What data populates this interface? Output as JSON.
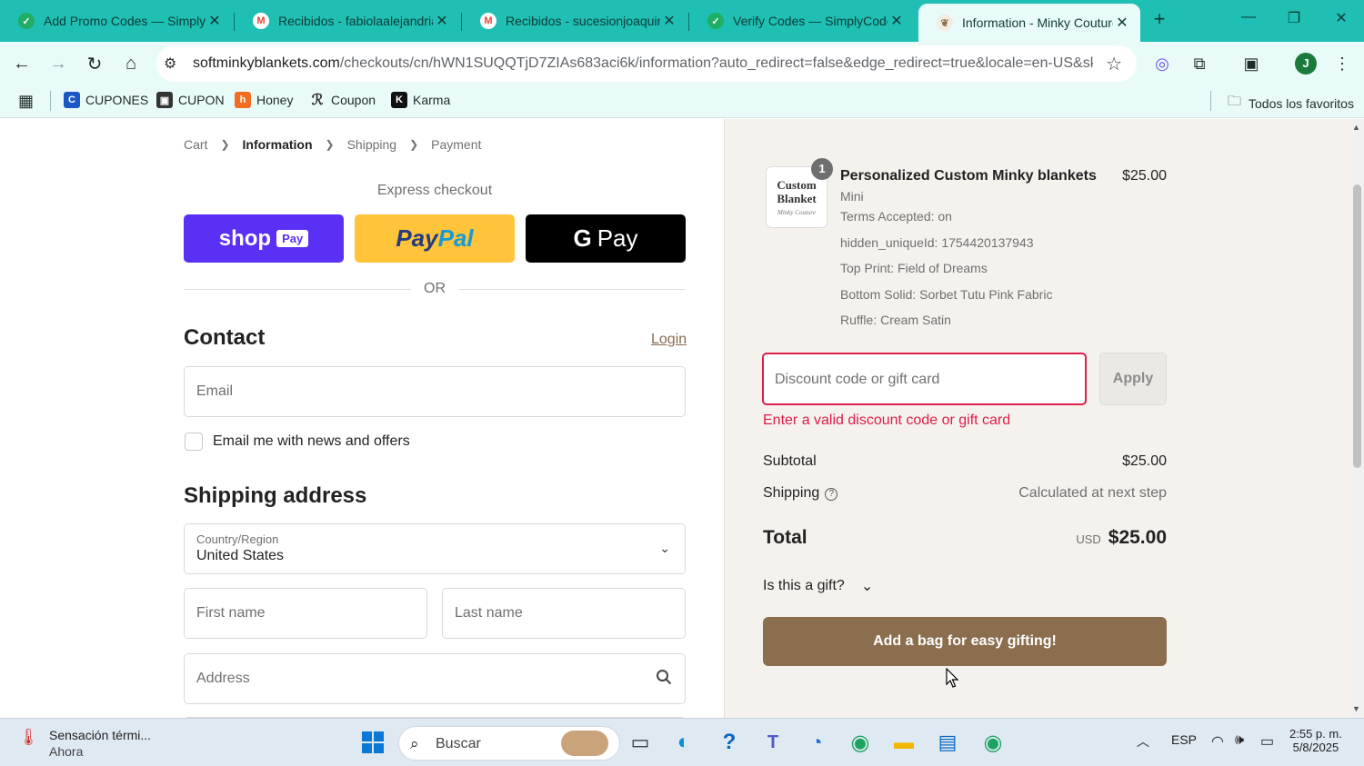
{
  "browser": {
    "tabs": [
      {
        "title": "Add Promo Codes — Simply",
        "favicon": "simplycodes-icon",
        "color": "#1fae64"
      },
      {
        "title": "Recibidos - fabiolaalejandria",
        "favicon": "gmail-icon",
        "color": "#ea4335"
      },
      {
        "title": "Recibidos - sucesionjoaquinh",
        "favicon": "gmail-icon",
        "color": "#ea4335"
      },
      {
        "title": "Verify Codes — SimplyCodes",
        "favicon": "simplycodes-icon",
        "color": "#1fae64"
      },
      {
        "title": "Information - Minky Couture",
        "favicon": "minky-icon",
        "color": "#8a6e4e"
      }
    ],
    "new_tab": "+",
    "url_domain": "softminkyblankets.com",
    "url_path": "/checkouts/cn/hWN1SUQQTjD7ZIAs683aci6k/information?auto_redirect=false&edge_redirect=true&locale=en-US&skip_...",
    "profile_initial": "J",
    "bookmarks": [
      {
        "label": "CUPONES",
        "color": "#1a56c4"
      },
      {
        "label": "CUPON",
        "color": "#333333"
      },
      {
        "label": "Honey",
        "color": "#f26c21"
      },
      {
        "label": "Coupon",
        "color": "#333333"
      },
      {
        "label": "Karma",
        "color": "#111111"
      }
    ],
    "all_bookmarks": "Todos los favoritos"
  },
  "checkout": {
    "breadcrumbs": [
      "Cart",
      "Information",
      "Shipping",
      "Payment"
    ],
    "express_checkout": "Express checkout",
    "shop_pay": {
      "shop": "shop",
      "pay": "Pay"
    },
    "paypal": {
      "pay": "Pay",
      "pal": "Pal"
    },
    "gpay": {
      "g": "G",
      "pay": "Pay"
    },
    "or": "OR",
    "contact_heading": "Contact",
    "login": "Login",
    "email_placeholder": "Email",
    "news_checkbox": "Email me with news and offers",
    "shipping_heading": "Shipping address",
    "country_label": "Country/Region",
    "country_value": "United States",
    "first_name": "First name",
    "last_name": "Last name",
    "address": "Address"
  },
  "summary": {
    "thumb_line1": "Custom",
    "thumb_line2": "Blanket",
    "thumb_brand": "Minky Couture",
    "quantity": "1",
    "product_name": "Personalized Custom Minky blankets",
    "product_price": "$25.00",
    "variant": "Mini",
    "meta": [
      "Terms Accepted: on",
      "hidden_uniqueId: 1754420137943",
      "Top Print: Field of Dreams",
      "Bottom Solid: Sorbet Tutu Pink Fabric",
      "Ruffle: Cream Satin"
    ],
    "discount_placeholder": "Discount code or gift card",
    "apply": "Apply",
    "error": "Enter a valid discount code or gift card",
    "subtotal_label": "Subtotal",
    "subtotal_value": "$25.00",
    "shipping_label": "Shipping",
    "shipping_value": "Calculated at next step",
    "total_label": "Total",
    "total_currency": "USD",
    "total_value": "$25.00",
    "gift_question": "Is this a gift?",
    "gift_bag_button": "Add a bag for easy gifting!"
  },
  "taskbar": {
    "weather_title": "Sensación térmi...",
    "weather_sub": "Ahora",
    "search": "Buscar",
    "language": "ESP",
    "time": "2:55 p. m.",
    "date": "5/8/2025"
  }
}
